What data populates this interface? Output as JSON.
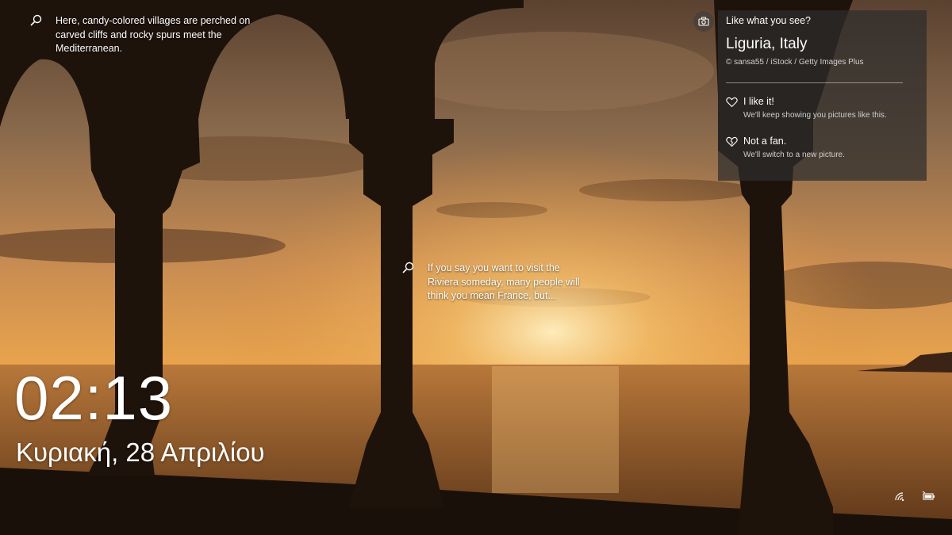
{
  "hotspots": [
    {
      "text": "Here, candy-colored villages are perched on carved cliffs and rocky spurs meet the Mediterranean.",
      "icon": "search-icon"
    },
    {
      "text": "If you say you want to visit the Riviera someday, many people will think you mean France, but...",
      "icon": "search-icon"
    }
  ],
  "spotlight": {
    "question": "Like what you see?",
    "location": "Liguria, Italy",
    "credit": "© sansa55 / iStock / Getty Images Plus",
    "camera_icon": "camera-icon",
    "like": {
      "title": "I like it!",
      "subtitle": "We'll keep showing you pictures like this.",
      "icon": "heart-icon"
    },
    "dislike": {
      "title": "Not a fan.",
      "subtitle": "We'll switch to a new picture.",
      "icon": "broken-heart-icon"
    }
  },
  "lockscreen": {
    "time": "02:13",
    "date": "Κυριακή, 28 Απριλίου"
  },
  "tray": {
    "network_icon": "wifi-icon",
    "battery_icon": "battery-icon"
  },
  "colors": {
    "sky_top": "#6b4a2e",
    "sun_glow": "#f4b25a",
    "sea": "#a86a32",
    "silhouette": "#1c120b",
    "panel_bg": "#2d2d2d"
  }
}
